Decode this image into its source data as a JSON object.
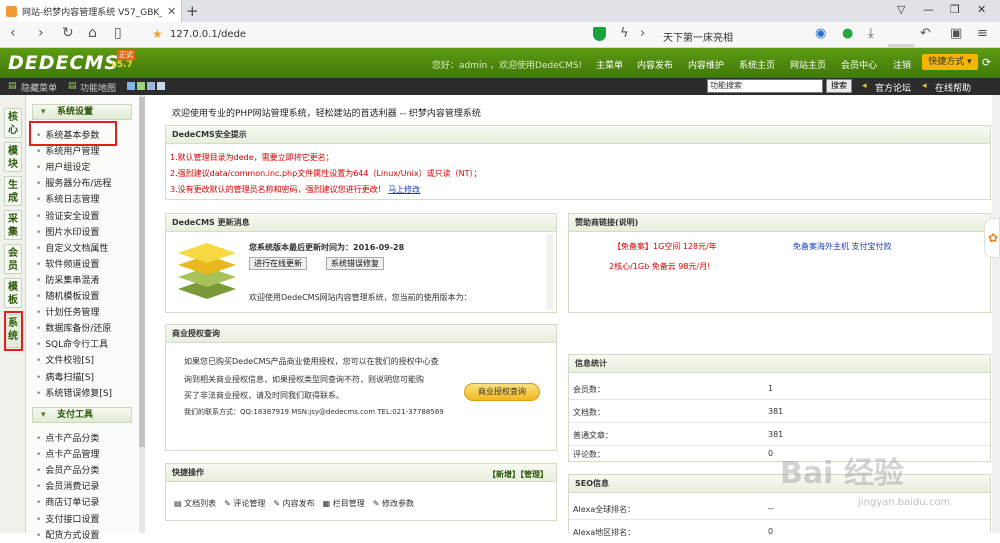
{
  "browser": {
    "tab_title": "网站-织梦内容管理系统 V57_GBK_S...",
    "url": "127.0.0.1/dede",
    "search_text": "天下第一床亮相"
  },
  "header": {
    "logo": "DEDECMS",
    "version": "v5.7",
    "badge": "正式",
    "welcome": "您好：admin ，欢迎使用DedeCMS!",
    "nav": [
      "主菜单",
      "内容发布",
      "内容维护",
      "系统主页",
      "网站主页",
      "会员中心",
      "注销"
    ],
    "fast_button": "快捷方式"
  },
  "toolbar": {
    "hide_menu": "隐藏菜单",
    "function_map": "功能地图",
    "search_value": "功能搜索",
    "search_button": "搜索",
    "official_forum": "官方论坛",
    "online_help": "在线帮助"
  },
  "vtabs": [
    "核心",
    "模块",
    "生成",
    "采集",
    "会员",
    "模板",
    "系统"
  ],
  "menu": {
    "group1": "系统设置",
    "items1": [
      "系统基本参数",
      "系统用户管理",
      "用户组设定",
      "服务器分布/远程",
      "系统日志管理",
      "验证安全设置",
      "图片水印设置",
      "自定义文档属性",
      "软件频道设置",
      "防采集串混淆",
      "随机模板设置",
      "计划任务管理",
      "数据库备份/还原",
      "SQL命令行工具",
      "文件校验[S]",
      "病毒扫描[S]",
      "系统错误修复[S]"
    ],
    "group2": "支付工具",
    "items2": [
      "点卡产品分类",
      "点卡产品管理",
      "会员产品分类",
      "会员消费记录",
      "商店订单记录",
      "支付接口设置",
      "配货方式设置"
    ]
  },
  "main": {
    "intro": "欢迎使用专业的PHP网站管理系统，轻松建站的首选利器 -- 织梦内容管理系统",
    "security": {
      "title": "DedeCMS安全提示",
      "line1": "1.默认管理目录为dede，需要立即将它更名；",
      "line2": "2.强烈建议data/common.inc.php文件属性设置为644（Linux/Unix）或只读（NT）；",
      "line3": "3.没有更改默认的管理员名称和密码，强烈建议您进行更改！",
      "line3_link": "马上修改"
    },
    "update": {
      "title": "DedeCMS 更新消息",
      "date_line": "您系统版本最后更新时间为：2016-09-28",
      "btn_update": "进行在线更新",
      "btn_fix": "系统错误修复",
      "text": "欢迎使用DedeCMS网站内容管理系统，您当前的使用版本为："
    },
    "sponsor": {
      "title": "赞助商链接",
      "note": "(说明)",
      "link1": "【免备案】1G空间 128元/年",
      "link2": "免备案海外主机 支付宝付款",
      "link3": "2核心/1Gb 免备云 98元/月!"
    },
    "license": {
      "title": "商业授权查询",
      "line1": "如果您已购买DedeCMS产品商业使用授权，您可以在我们的授权中心查",
      "line2": "询到相关商业授权信息，如果授权类型同查询不符，则说明您可能购",
      "line3": "买了非法商业授权，请及时同我们取得联系。",
      "line4": "我们的联系方式：QQ:18387919 MSN:jsy@dedecms.com TEL:021-37788569",
      "button": "商业授权查询"
    },
    "stats": {
      "title": "信息统计",
      "rows": [
        {
          "k": "会员数：",
          "v": "1"
        },
        {
          "k": "文档数：",
          "v": "381"
        },
        {
          "k": "普通文章：",
          "v": "381"
        },
        {
          "k": "评论数：",
          "v": "0"
        }
      ]
    },
    "quick": {
      "title": "快捷操作",
      "links": "【新增】【管理】",
      "items": [
        "文档列表",
        "评论管理",
        "内容发布",
        "栏目管理",
        "修改参数"
      ]
    },
    "seo": {
      "title": "SEO信息",
      "rows": [
        {
          "k": "Alexa全球排名：",
          "v": "--"
        },
        {
          "k": "Alexa地区排名：",
          "v": "0"
        }
      ]
    }
  },
  "watermark": {
    "text": "Bai 经验",
    "sub": "jingyan.baidu.com"
  }
}
